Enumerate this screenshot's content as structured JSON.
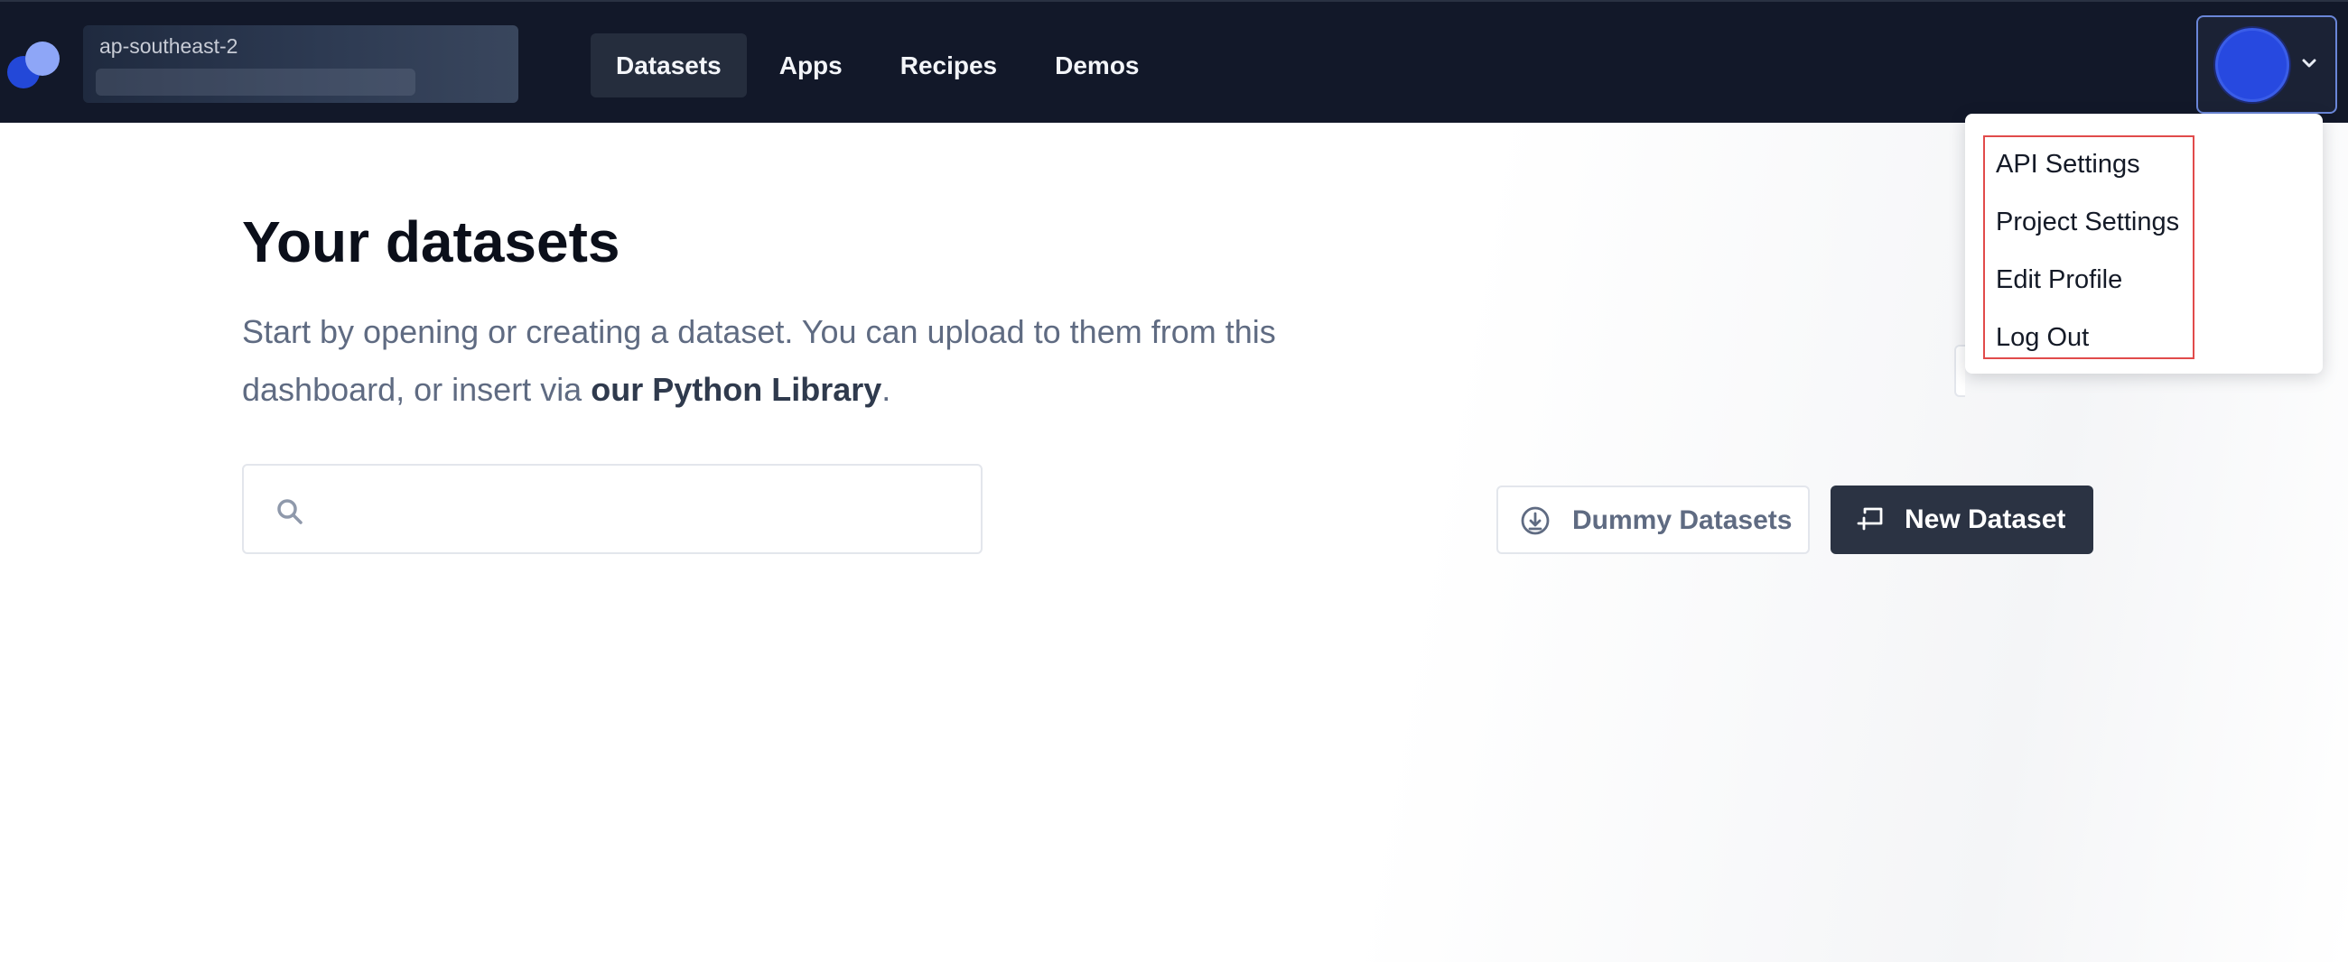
{
  "header": {
    "region": {
      "name": "ap-southeast-2"
    },
    "nav": [
      {
        "label": "Datasets",
        "active": true
      },
      {
        "label": "Apps",
        "active": false
      },
      {
        "label": "Recipes",
        "active": false
      },
      {
        "label": "Demos",
        "active": false
      }
    ]
  },
  "account_menu": {
    "items": [
      {
        "label": "API Settings"
      },
      {
        "label": "Project Settings"
      },
      {
        "label": "Edit Profile"
      },
      {
        "label": "Log Out"
      }
    ]
  },
  "main": {
    "title": "Your datasets",
    "intro_text": "Start by opening or creating a dataset. You can upload to them from this dashboard, or insert via ",
    "intro_link": "our Python Library",
    "intro_end": ".",
    "search": {
      "placeholder": "",
      "value": ""
    },
    "dummy_button_label": "Dummy Datasets",
    "new_button_label": "New Dataset"
  },
  "colors": {
    "header_bg": "#121829",
    "accent": "#2749e0",
    "primary_button": "#2b3343",
    "highlight_box": "#e14b4b"
  },
  "icons": [
    "logo",
    "avatar",
    "chevron-down-icon",
    "search-icon",
    "download-circle-icon",
    "new-dataset-icon"
  ]
}
